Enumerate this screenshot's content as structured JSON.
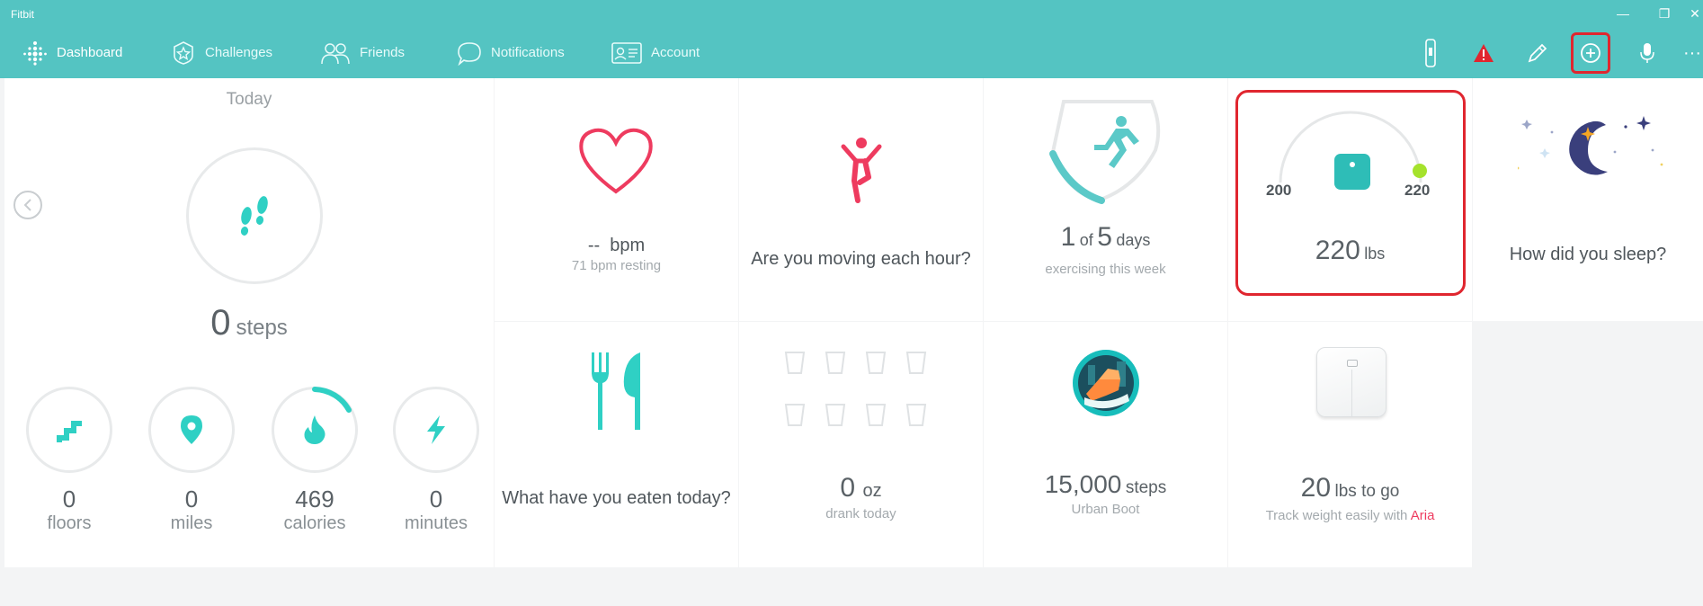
{
  "window": {
    "title": "Fitbit",
    "minimize": "—",
    "restore": "❐",
    "close": "✕"
  },
  "nav": {
    "items": [
      {
        "label": "Dashboard",
        "icon": "dashboard-dots-icon"
      },
      {
        "label": "Challenges",
        "icon": "star-badge-icon"
      },
      {
        "label": "Friends",
        "icon": "friends-icon"
      },
      {
        "label": "Notifications",
        "icon": "chat-bubble-icon"
      },
      {
        "label": "Account",
        "icon": "id-card-icon"
      }
    ],
    "more": "···"
  },
  "steps_panel": {
    "day_label": "Today",
    "steps_value": "0",
    "steps_unit": "steps",
    "stats": [
      {
        "value": "0",
        "label": "floors",
        "icon": "stairs-icon"
      },
      {
        "value": "0",
        "label": "miles",
        "icon": "location-pin-icon"
      },
      {
        "value": "469",
        "label": "calories",
        "icon": "flame-icon"
      },
      {
        "value": "0",
        "label": "minutes",
        "icon": "lightning-icon"
      }
    ]
  },
  "tiles": {
    "heart": {
      "value": "--",
      "unit": "bpm",
      "sub": "71 bpm resting"
    },
    "hourly": {
      "question": "Are you moving each hour?"
    },
    "exercise": {
      "done": "1",
      "of": "of",
      "goal": "5",
      "unit": "days",
      "sub": "exercising this week"
    },
    "weight": {
      "min": "200",
      "max": "220",
      "value": "220",
      "unit": "lbs"
    },
    "sleep": {
      "question": "How did you sleep?"
    },
    "food": {
      "question": "What have you eaten today?"
    },
    "water": {
      "value": "0",
      "unit": "oz",
      "sub": "drank today",
      "cups_filled": 0,
      "cups_total": 8
    },
    "badge": {
      "value": "15,000",
      "unit": "steps",
      "sub": "Urban Boot"
    },
    "aria": {
      "value": "20",
      "unit": "lbs to go",
      "sub_prefix": "Track weight easily with",
      "sub_link": "Aria"
    }
  },
  "colors": {
    "teal": "#54c4c2",
    "accent_teal": "#2fd0c4",
    "pink": "#ee3b5f",
    "red_highlight": "#e0262f",
    "lime": "#a5e22c",
    "navy": "#3a3f7c"
  }
}
